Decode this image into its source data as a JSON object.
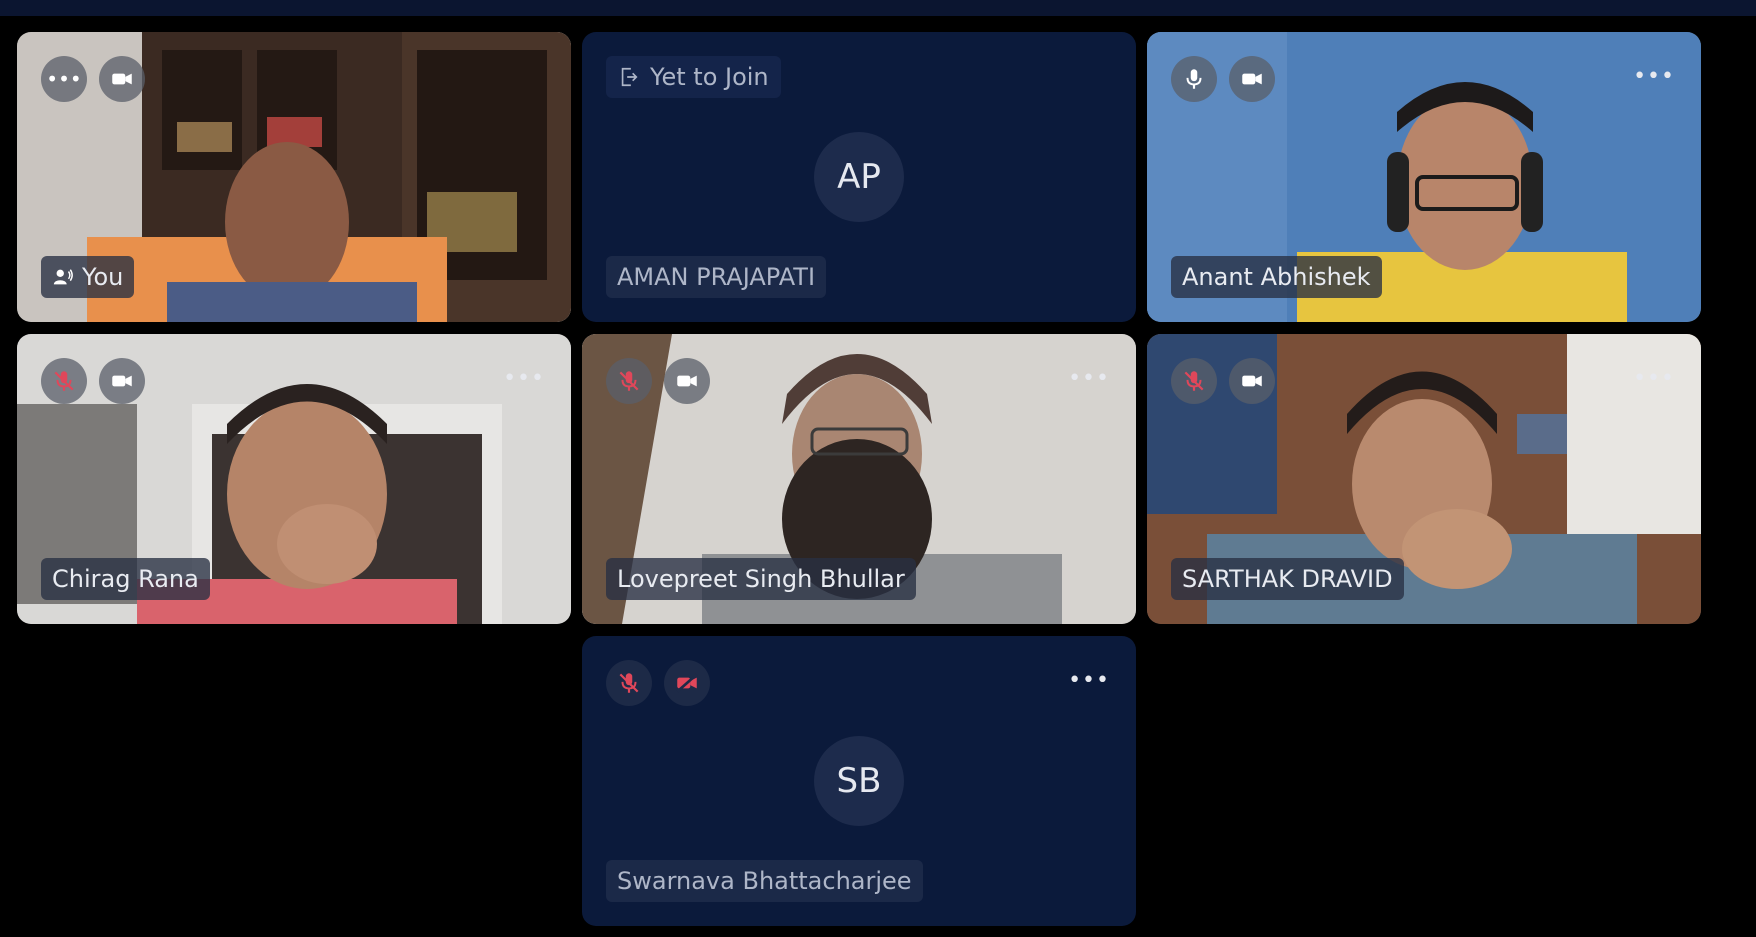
{
  "participants": [
    {
      "name": "You"
    },
    {
      "name": "AMAN PRAJAPATI",
      "initials": "AP",
      "status": "Yet to Join"
    },
    {
      "name": "Anant Abhishek"
    },
    {
      "name": "Chirag Rana"
    },
    {
      "name": "Lovepreet Singh Bhullar"
    },
    {
      "name": "SARTHAK DRAVID"
    },
    {
      "name": "Swarnava Bhattacharjee",
      "initials": "SB"
    }
  ],
  "icons": {
    "more": "more-options-icon",
    "mic": "microphone-icon",
    "mic_off": "microphone-muted-icon",
    "cam": "video-camera-icon",
    "cam_off": "video-camera-off-icon",
    "speaking": "speaking-user-icon",
    "exit": "exit-icon"
  },
  "colors": {
    "background": "#000000",
    "tile_bg": "#0b1a3b",
    "muted_red": "#e0475a",
    "name_text": "#e8ebf1"
  }
}
